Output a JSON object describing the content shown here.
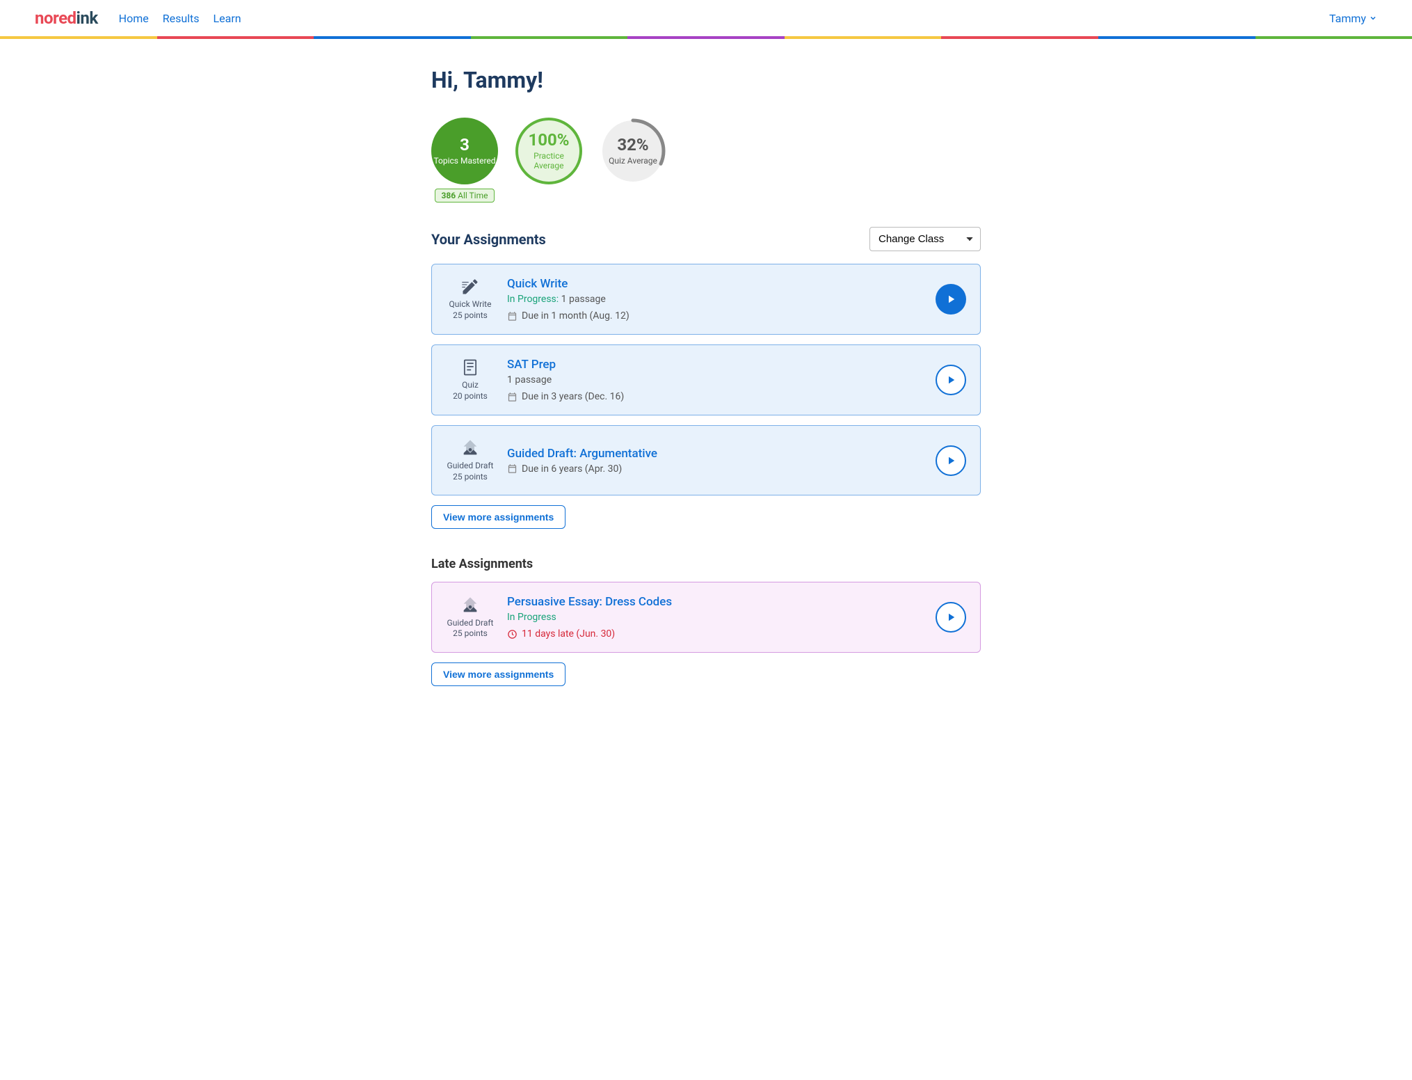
{
  "header": {
    "logo_no": "no",
    "logo_red": "red",
    "logo_ink": "ink",
    "nav": [
      "Home",
      "Results",
      "Learn"
    ],
    "user": "Tammy"
  },
  "greeting": "Hi, Tammy!",
  "stats": {
    "mastered": {
      "value": "3",
      "label": "Topics Mastered",
      "badge_num": "386",
      "badge_text": " All Time"
    },
    "practice": {
      "value": "100%",
      "label": "Practice Average"
    },
    "quiz": {
      "value": "32%",
      "label": "Quiz Average"
    }
  },
  "assignments_title": "Your Assignments",
  "class_select": "Change Class",
  "assignments": [
    {
      "icon_type": "Quick Write",
      "icon_points": "25 points",
      "title": "Quick Write",
      "status_prefix": "In Progress:",
      "status_rest": " 1 passage",
      "due": "Due in 1 month (Aug. 12)",
      "play_style": "solid"
    },
    {
      "icon_type": "Quiz",
      "icon_points": "20 points",
      "title": "SAT Prep",
      "status_prefix": "",
      "status_rest": "1 passage",
      "due": "Due in 3 years (Dec. 16)",
      "play_style": "outline"
    },
    {
      "icon_type": "Guided Draft",
      "icon_points": "25 points",
      "title": "Guided Draft: Argumentative",
      "status_prefix": "",
      "status_rest": "",
      "due": "Due in 6 years (Apr. 30)",
      "play_style": "outline"
    }
  ],
  "view_more": "View more assignments",
  "late_title": "Late Assignments",
  "late_assignments": [
    {
      "icon_type": "Guided Draft",
      "icon_points": "25 points",
      "title": "Persuasive Essay: Dress Codes",
      "status_prefix": "In Progress",
      "status_rest": "",
      "due": "11 days late (Jun. 30)",
      "play_style": "outline"
    }
  ]
}
